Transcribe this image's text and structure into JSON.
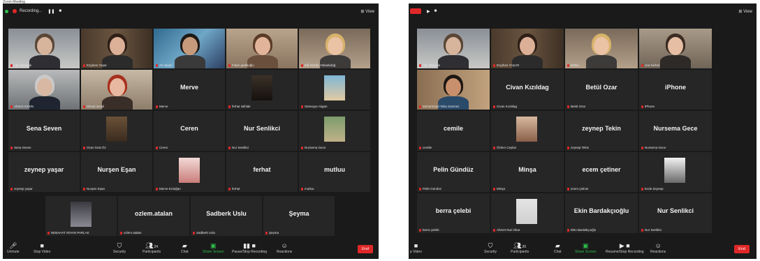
{
  "left": {
    "window_title": "Zoom Meeting",
    "recording_label": "Recording...",
    "pause_icon": "❚❚",
    "stop_icon": "■",
    "view_label": "⊞ View",
    "tiles": [
      {
        "kind": "video",
        "label": "Alp Albayrak",
        "scene": "boy"
      },
      {
        "kind": "video",
        "label": "Ezgihan Yaşar",
        "scene": "woman-shelf"
      },
      {
        "kind": "video",
        "label": "Ali Vasari",
        "scene": "man-painting",
        "active": true
      },
      {
        "kind": "video",
        "label": "Fidan gedikoğlu",
        "scene": "woman-curly"
      },
      {
        "kind": "video",
        "label": "Elif Gözde Yüksekdağ",
        "scene": "blonde"
      },
      {
        "kind": "video",
        "label": "Ahmet HASIN",
        "scene": "oldman"
      },
      {
        "kind": "video",
        "label": "Dilsad ismail",
        "scene": "redhair"
      },
      {
        "kind": "name",
        "name": "Merve",
        "label": "Merve"
      },
      {
        "kind": "avatar",
        "label": "ferhat istihlak",
        "scene": "dark-avatar"
      },
      {
        "kind": "avatar",
        "label": "Sümeyye Akgün",
        "scene": "beach-avatar"
      },
      {
        "kind": "name",
        "name": "Sena Seven",
        "label": "Sena Seven"
      },
      {
        "kind": "avatar",
        "label": "Ozan İsrat Öz",
        "scene": "brown-avatar"
      },
      {
        "kind": "name",
        "name": "Ceren",
        "label": "Ceren"
      },
      {
        "kind": "name",
        "name": "Nur Senlikci",
        "label": "Nur Senlikci"
      },
      {
        "kind": "avatar",
        "label": "Nursema Gece",
        "scene": "nature-avatar"
      },
      {
        "kind": "name",
        "name": "zeynep yaşar",
        "label": "zeynep yaşar"
      },
      {
        "kind": "name",
        "name": "Nurşen Eşan",
        "label": "Nurşen Eşan"
      },
      {
        "kind": "avatar",
        "label": "Merve Erdoğan",
        "scene": "pink-avatar"
      },
      {
        "kind": "name",
        "name": "ferhat",
        "label": "ferhat"
      },
      {
        "kind": "name",
        "name": "mutluu",
        "label": "mutluu"
      }
    ],
    "last_row": [
      {
        "kind": "avatar",
        "label": "NEBAHAT NİHAN PARLAK",
        "scene": "car-avatar"
      },
      {
        "kind": "name",
        "name": "ozlem.atalan",
        "label": "ozlem.atalan"
      },
      {
        "kind": "name",
        "name": "Sadberk Uslu",
        "label": "Sadberk Uslu"
      },
      {
        "kind": "name",
        "name": "Şeyma",
        "label": "Şeyma"
      }
    ],
    "toolbar": {
      "unmute": "Unmute",
      "stop_video": "Stop Video",
      "security": "Security",
      "participants": "Participants",
      "participants_count": "24",
      "chat": "Chat",
      "share_screen": "Share Screen",
      "pause_stop_recording": "Pause/Stop Recording",
      "reactions": "Reactions",
      "end": "End"
    }
  },
  "right": {
    "view_label": "⊞ View",
    "tiles": [
      {
        "kind": "video",
        "label": "Alp Albayrak",
        "scene": "boy",
        "active": true
      },
      {
        "kind": "video",
        "label": "Ezgihan YAŞAR",
        "scene": "woman-shelf"
      },
      {
        "kind": "video",
        "label": "ESRA",
        "scene": "blonde"
      },
      {
        "kind": "video",
        "label": "Jea Nichel",
        "scene": "glasses-woman"
      },
      {
        "kind": "video",
        "label": "Muhammed Taha Sönmez",
        "scene": "young-man"
      },
      {
        "kind": "name",
        "name": "Civan Kızıldag",
        "label": "Civan Kızıldag"
      },
      {
        "kind": "name",
        "name": "Betül Ozar",
        "label": "Betül Ozar"
      },
      {
        "kind": "name",
        "name": "iPhone",
        "label": "iPhone"
      },
      {
        "kind": "name",
        "name": "cemile",
        "label": "cemile"
      },
      {
        "kind": "avatar",
        "label": "Özlem Ceylan",
        "scene": "woman-avatar"
      },
      {
        "kind": "name",
        "name": "zeynep Tekin",
        "label": "zeynep Tekin"
      },
      {
        "kind": "name",
        "name": "Nursema Gece",
        "label": "Nursema Gece"
      },
      {
        "kind": "name",
        "name": "Pelin Gündüz",
        "label": "Pelin Gündüz"
      },
      {
        "kind": "name",
        "name": "Minşa",
        "label": "Minşa"
      },
      {
        "kind": "name",
        "name": "ecem çetiner",
        "label": "ecem çetiner"
      },
      {
        "kind": "avatar",
        "label": "Ecde Zeynep",
        "scene": "sketch-avatar"
      },
      {
        "kind": "name",
        "name": "berra çelebi",
        "label": "berra çelebi"
      },
      {
        "kind": "avatar",
        "label": "Ahmet Nuri Okur",
        "scene": "blank-avatar"
      },
      {
        "kind": "name",
        "name": "Ekin Bardakçıoğlu",
        "label": "Ekin Bardakçıoğlu"
      },
      {
        "kind": "name",
        "name": "Nur Senlikci",
        "label": "Nur Senlikci"
      }
    ],
    "toolbar": {
      "stop_video": "p Video",
      "security": "Security",
      "participants": "Participants",
      "participants_count": "20",
      "chat": "Chat",
      "share_screen": "Share Screen",
      "pause_stop_recording": "Resume/Stop Recording",
      "reactions": "Reactions",
      "end": "End"
    }
  },
  "colors": {
    "end": "#e02828",
    "share": "#2fbf4b",
    "active_border": "#c9d13a",
    "background": "#1a1a1a"
  }
}
